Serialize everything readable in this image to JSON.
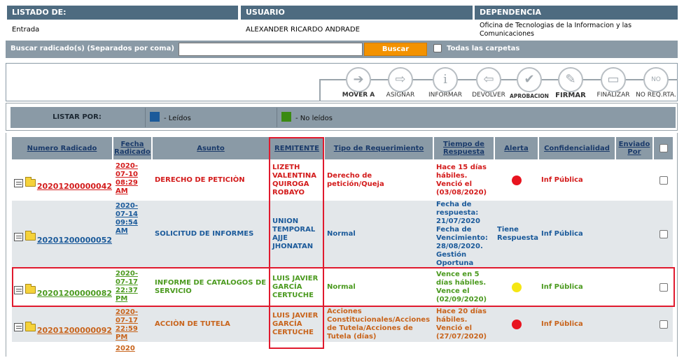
{
  "header": {
    "listado_title": "LISTADO DE:",
    "listado_value": "Entrada",
    "usuario_title": "USUARIO",
    "usuario_value": "ALEXANDER RICARDO ANDRADE",
    "dependencia_title": "DEPENDENCIA",
    "dependencia_value": "Oficina de Tecnologias de la Informacion y las Comunicaciones"
  },
  "search": {
    "label": "Buscar radicado(s) (Separados por coma)",
    "value": "",
    "button": "Buscar",
    "all_folders_label": "Todas las carpetas"
  },
  "toolbar": [
    {
      "label": "MOVER A",
      "icon": "arrow-right-icon"
    },
    {
      "label": "ASIGNAR",
      "icon": "assign-icon"
    },
    {
      "label": "INFORMAR",
      "icon": "info-icon"
    },
    {
      "label": "DEVOLVER",
      "icon": "return-icon"
    },
    {
      "label": "APROBACION",
      "icon": "check-icon"
    },
    {
      "label": "FIRMAR",
      "icon": "sign-icon"
    },
    {
      "label": "FINALIZAR",
      "icon": "finish-icon"
    },
    {
      "label": "NO REQ.RTA.",
      "icon": "no-reply-icon"
    }
  ],
  "listar": {
    "label": "LISTAR POR:",
    "read_label": "- Leídos",
    "unread_label": "- No leídos",
    "read_color": "#1b5a9a",
    "unread_color": "#3a8a12"
  },
  "columns": [
    "Numero Radicado",
    "Fecha Radicado",
    "Asunto",
    "REMITENTE",
    "Tipo de Requerimiento",
    "Tiempo de Respuesta",
    "Alerta",
    "Confidencialidad",
    "Enviado Por"
  ],
  "rows": [
    {
      "radicado": "20201200000042",
      "fecha": "2020-\n07-10\n08:29\nAM",
      "asunto": "DERECHO DE PETICIÒN",
      "remitente": "LIZETH\nVALENTINA\nQUIROGA\nROBAYO",
      "tipo": "Derecho de\npetición/Queja",
      "tiempo": "Hace 15 días\nhábiles.\nVenció el\n(03/08/2020)",
      "alerta": "#e8141f",
      "confidencialidad": "Inf Pública",
      "enviado": "",
      "color": "red"
    },
    {
      "radicado": "20201200000052",
      "fecha": "2020-\n07-14\n09:54\nAM",
      "asunto": "SOLICITUD DE INFORMES",
      "remitente": "UNION\nTEMPORAL\nAJJE\nJHONATAN",
      "tipo": "Normal",
      "tiempo": "Fecha de\nrespuesta:\n21/07/2020\nFecha de\nVencimiento:\n28/08/2020.\nGestión\nOportuna",
      "alerta_text": "Tiene\nRespuesta",
      "confidencialidad": "Inf Pública",
      "enviado": "",
      "color": "blue"
    },
    {
      "radicado": "20201200000082",
      "fecha": "2020-\n07-17\n22:37\nPM",
      "asunto": "INFORME DE CATALOGOS DE\nSERVICIO",
      "remitente": "LUIS JAVIER\nGARCÍA\nCERTUCHE",
      "tipo": "Normal",
      "tiempo": "Vence en 5\ndías hábiles.\nVence el\n(02/09/2020)",
      "alerta": "#f5e614",
      "confidencialidad": "Inf Pública",
      "enviado": "",
      "color": "green"
    },
    {
      "radicado": "20201200000092",
      "fecha": "2020-\n07-17\n22:59\nPM",
      "asunto": "ACCIÒN DE TUTELA",
      "remitente": "LUIS JAVIER\nGARCÍA\nCERTUCHE",
      "tipo": "Acciones\nConstitucionales/Acciones\nde Tutela/Acciones de\nTutela (días)",
      "tiempo": "Hace 20 días\nhábiles.\nVenció el\n(27/07/2020)",
      "alerta": "#e8141f",
      "confidencialidad": "Inf Pública",
      "enviado": "",
      "color": "orange"
    }
  ],
  "partial_row_fecha": "2020"
}
